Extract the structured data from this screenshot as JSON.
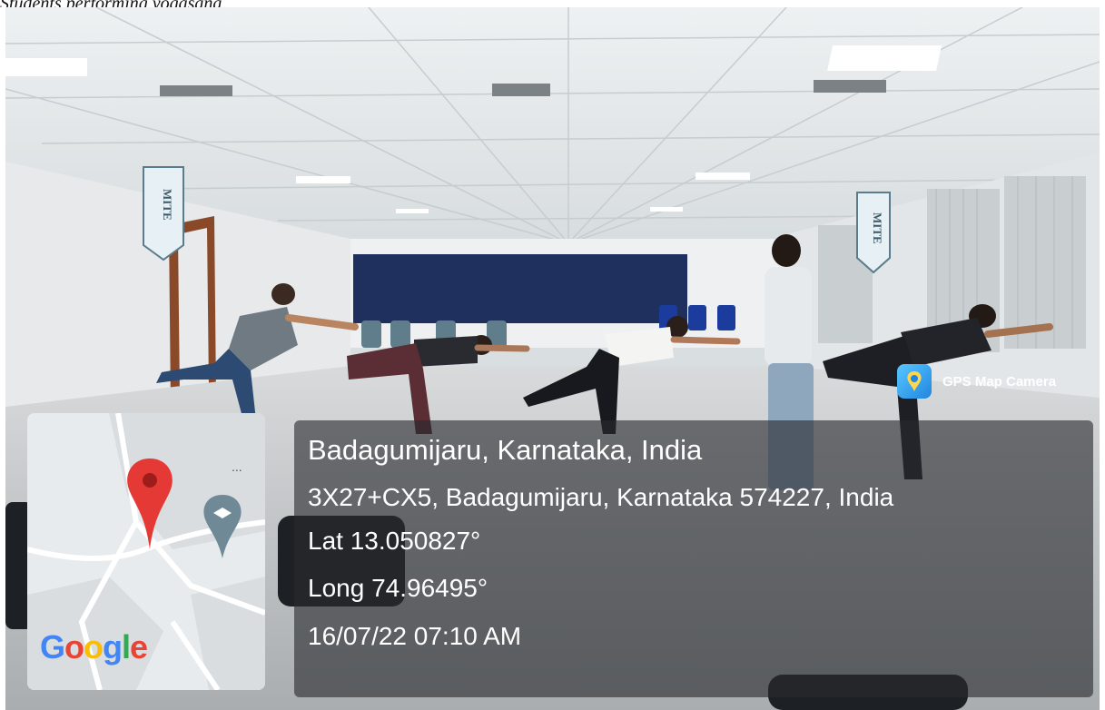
{
  "caption": "Students performing yogasana",
  "photo": {
    "banners": [
      "MITE",
      "MITE"
    ]
  },
  "geotag": {
    "app_name": "GPS Map Camera",
    "place": "Badagumijaru, Karnataka, India",
    "address": "3X27+CX5, Badagumijaru, Karnataka 574227, India",
    "latitude": "Lat 13.050827°",
    "longitude": "Long 74.96495°",
    "datetime": "16/07/22 07:10 AM"
  },
  "map": {
    "provider": "Google",
    "more_indicator": "..."
  },
  "colors": {
    "pin_red": "#e53935",
    "pin_grey": "#6f8a96",
    "overlay": "#282a2e"
  }
}
